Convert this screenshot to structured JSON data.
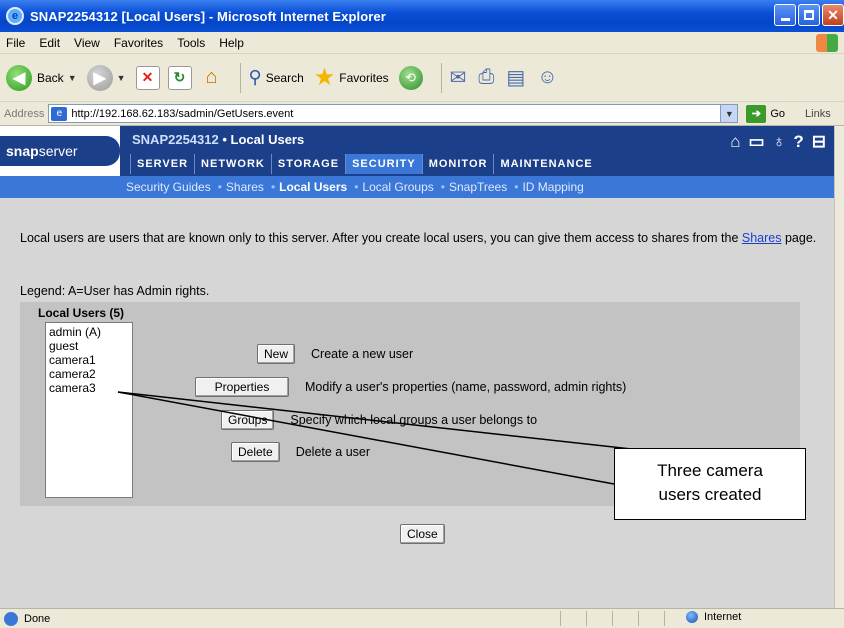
{
  "window": {
    "title": "SNAP2254312 [Local Users] - Microsoft Internet Explorer"
  },
  "menu": [
    "File",
    "Edit",
    "View",
    "Favorites",
    "Tools",
    "Help"
  ],
  "toolbar": {
    "back": "Back",
    "search": "Search",
    "favorites": "Favorites"
  },
  "address": {
    "label": "Address",
    "url": "http://192.168.62.183/sadmin/GetUsers.event",
    "go": "Go",
    "links": "Links"
  },
  "header": {
    "logo_bold": "snap",
    "logo_light": "server",
    "server_name": "SNAP2254312",
    "sep": " • ",
    "page_name": "Local Users",
    "tabs": [
      "SERVER",
      "NETWORK",
      "STORAGE",
      "SECURITY",
      "MONITOR",
      "MAINTENANCE"
    ],
    "active_tab": "SECURITY"
  },
  "subnav": [
    "Security Guides",
    "Shares",
    "Local Users",
    "Local Groups",
    "SnapTrees",
    "ID Mapping"
  ],
  "intro": {
    "before_link": "Local users are users that are known only to this server. After you create local users, you can give them access to shares from the ",
    "link": "Shares",
    "after_link": " page."
  },
  "legend": "Legend: A=User has Admin rights.",
  "panel": {
    "title": "Local Users (5)",
    "users": [
      "admin (A)",
      "guest",
      "camera1",
      "camera2",
      "camera3"
    ],
    "actions": [
      {
        "button": "New",
        "description": "Create a new user"
      },
      {
        "button": "Properties",
        "description": "Modify a user's properties (name, password, admin rights)"
      },
      {
        "button": "Groups",
        "description": "Specify which local groups a user belongs to"
      },
      {
        "button": "Delete",
        "description": "Delete a user"
      }
    ]
  },
  "close_label": "Close",
  "callout": {
    "line1": "Three camera",
    "line2": "users created"
  },
  "status": {
    "left": "Done",
    "zone": "Internet"
  }
}
